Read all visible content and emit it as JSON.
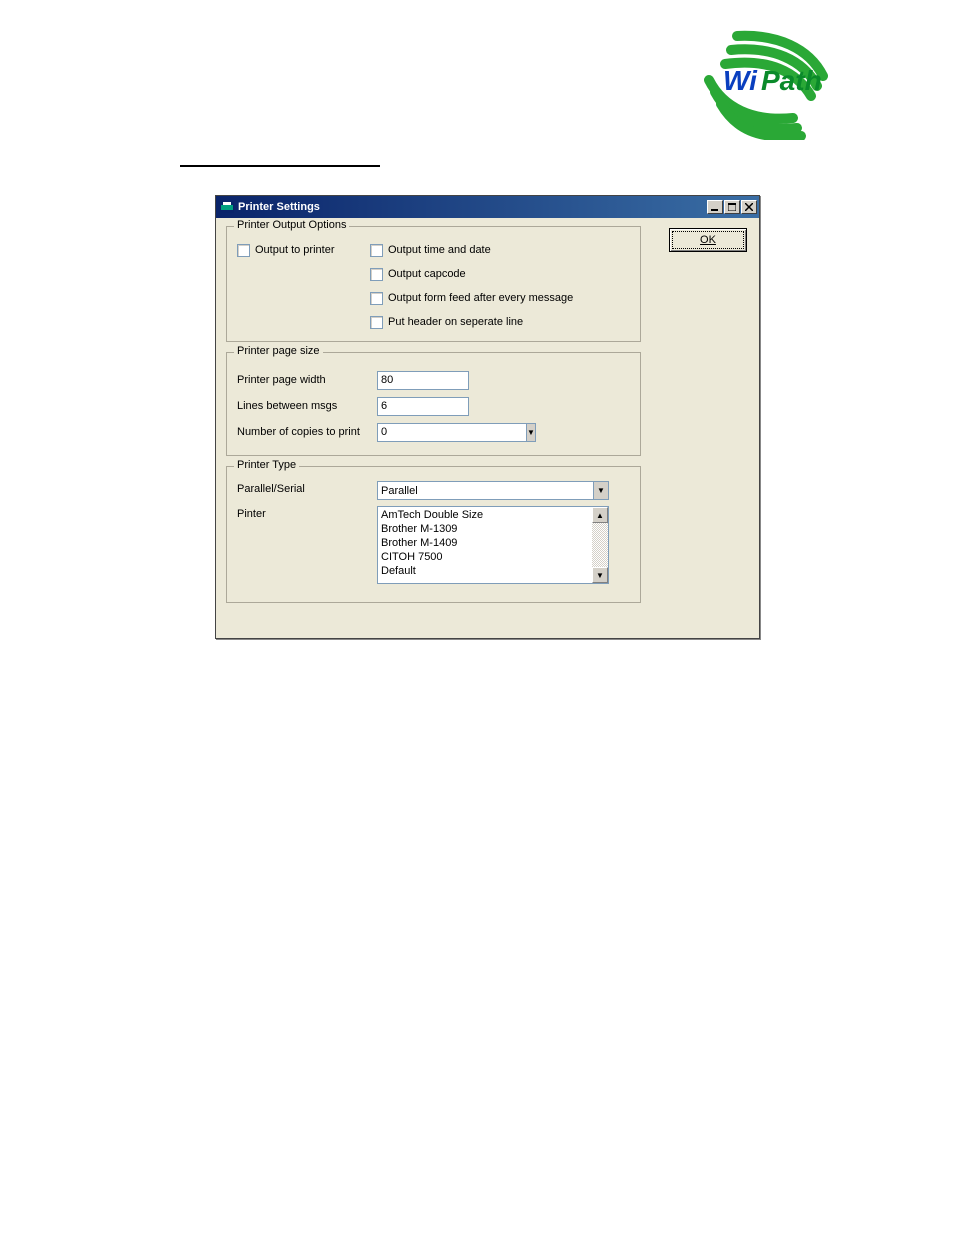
{
  "logo_brand_wi": "Wi",
  "logo_brand_path": "Path",
  "window": {
    "title": "Printer Settings",
    "ok_label": "OK"
  },
  "output_group": {
    "legend": "Printer Output Options",
    "output_to_printer": "Output to printer",
    "output_time_date": "Output time and date",
    "output_capcode": "Output capcode",
    "output_form_feed": "Output form feed after every message",
    "put_header": "Put header on seperate line"
  },
  "page_group": {
    "legend": "Printer page size",
    "page_width_label": "Printer page width",
    "page_width_value": "80",
    "lines_between_label": "Lines between msgs",
    "lines_between_value": "6",
    "copies_label": "Number of copies to print",
    "copies_value": "0"
  },
  "type_group": {
    "legend": "Printer Type",
    "parallel_serial_label": "Parallel/Serial",
    "parallel_serial_value": "Parallel",
    "printer_label": "Pinter",
    "printers": [
      "AmTech Double Size",
      "Brother M-1309",
      "Brother M-1409",
      "CITOH 7500",
      "Default"
    ]
  }
}
